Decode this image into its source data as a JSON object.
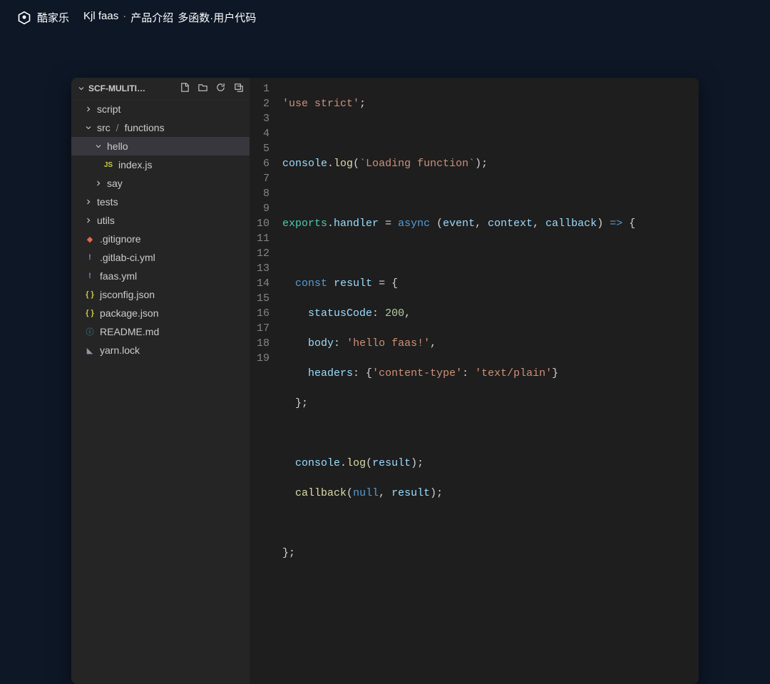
{
  "header": {
    "brand": "酷家乐",
    "product": "Kjl faas",
    "sep1": "·",
    "nav1": "产品介绍",
    "nav2": "多函数·用户代码"
  },
  "sidebar": {
    "root": "SCF-MULITI…",
    "items": {
      "script": "script",
      "src": "src",
      "functions": "functions",
      "hello": "hello",
      "indexjs": "index.js",
      "say": "say",
      "tests": "tests",
      "utils": "utils",
      "gitignore": ".gitignore",
      "gitlabci": ".gitlab-ci.yml",
      "faasyml": "faas.yml",
      "jsconfig": "jsconfig.json",
      "packagejson": "package.json",
      "readme": "README.md",
      "yarnlock": "yarn.lock"
    },
    "icons": {
      "js": "JS",
      "yml": "!",
      "json": "{ }",
      "git": "◆",
      "md": "ⓘ",
      "lock": "◣"
    }
  },
  "code": {
    "lines": [
      "1",
      "2",
      "3",
      "4",
      "5",
      "6",
      "7",
      "8",
      "9",
      "10",
      "11",
      "12",
      "13",
      "14",
      "15",
      "16",
      "17",
      "18",
      "19"
    ],
    "l1_str": "'use strict'",
    "l3_console": "console",
    "l3_log": "log",
    "l3_tmpl": "`Loading function`",
    "l5_exports": "exports",
    "l5_handler": "handler",
    "l5_async": "async",
    "l5_event": "event",
    "l5_context": "context",
    "l5_callback": "callback",
    "l7_const": "const",
    "l7_result": "result",
    "l8_key": "statusCode",
    "l8_val": "200",
    "l9_key": "body",
    "l9_val": "'hello faas!'",
    "l10_key": "headers",
    "l10_ct": "'content-type'",
    "l10_tp": "'text/plain'",
    "l13_console": "console",
    "l13_log": "log",
    "l13_arg": "result",
    "l14_cb": "callback",
    "l14_null": "null",
    "l14_res": "result"
  }
}
